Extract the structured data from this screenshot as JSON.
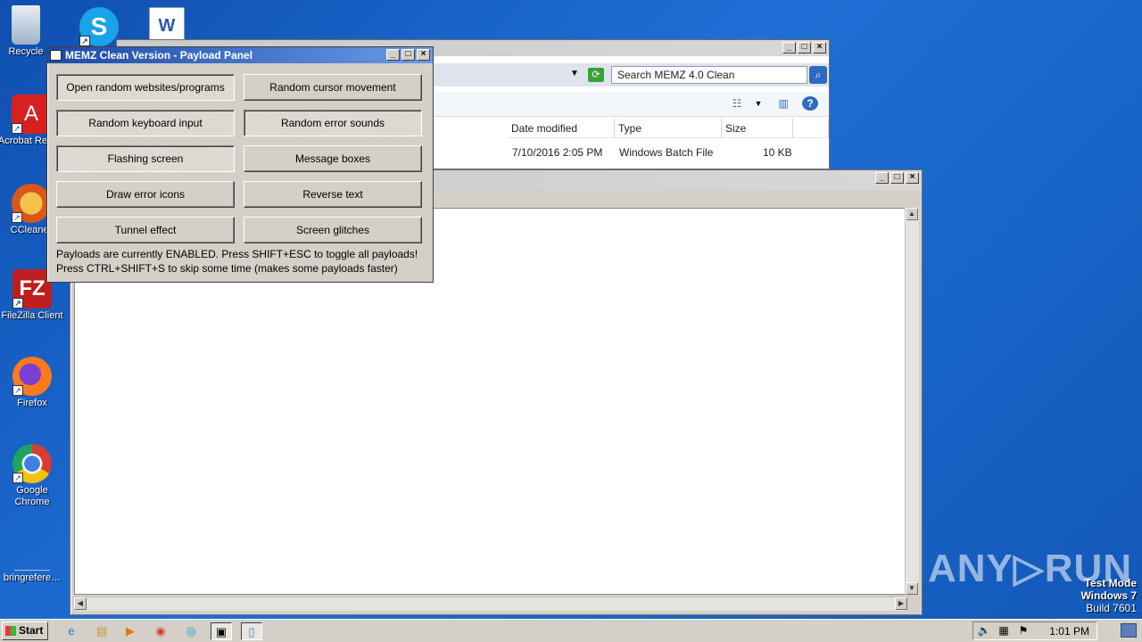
{
  "desktop": {
    "icons": [
      {
        "label": "Recycle",
        "icon": "recycle-bin-icon"
      },
      {
        "label": "Acrobat Reader",
        "icon": "acrobat-icon"
      },
      {
        "label": "CCleaner",
        "icon": "ccleaner-icon"
      },
      {
        "label": "FileZilla Client",
        "icon": "filezilla-icon"
      },
      {
        "label": "Firefox",
        "icon": "firefox-icon"
      },
      {
        "label": "Google Chrome",
        "icon": "chrome-icon"
      },
      {
        "label": "bringrefere…",
        "icon": "file-icon"
      }
    ],
    "top_icons": [
      {
        "icon": "skype-icon"
      },
      {
        "icon": "word-icon"
      }
    ]
  },
  "explorer": {
    "search_placeholder": "Search MEMZ 4.0 Clean",
    "columns": {
      "date": "Date modified",
      "type": "Type",
      "size": "Size"
    },
    "row": {
      "date": "7/10/2016 2:05 PM",
      "type": "Windows Batch File",
      "size": "10 KB"
    }
  },
  "panel": {
    "title": "MEMZ Clean Version - Payload Panel",
    "buttons": [
      {
        "label": "Open random websites/programs",
        "enabled": true
      },
      {
        "label": "Random cursor movement",
        "enabled": false
      },
      {
        "label": "Random keyboard input",
        "enabled": true
      },
      {
        "label": "Random error sounds",
        "enabled": true
      },
      {
        "label": "Flashing screen",
        "enabled": true
      },
      {
        "label": "Message boxes",
        "enabled": false
      },
      {
        "label": "Draw error icons",
        "enabled": false
      },
      {
        "label": "Reverse text",
        "enabled": false
      },
      {
        "label": "Tunnel effect",
        "enabled": false
      },
      {
        "label": "Screen glitches",
        "enabled": false
      }
    ],
    "status_line1": "Payloads are currently ENABLED. Press SHIFT+ESC to toggle all payloads!",
    "status_line2": "Press CTRL+SHIFT+S to skip some time (makes some payloads faster)"
  },
  "watermark": {
    "text": "ANY▷RUN"
  },
  "system": {
    "mode": "Test Mode",
    "os": "Windows 7",
    "build": "Build 7601"
  },
  "taskbar": {
    "start_label": "Start",
    "clock": "1:01 PM",
    "apps": [
      "ie-icon",
      "explorer-icon",
      "media-player-icon",
      "chrome-icon",
      "edge-icon",
      "memz-icon",
      "notepad-icon"
    ]
  }
}
